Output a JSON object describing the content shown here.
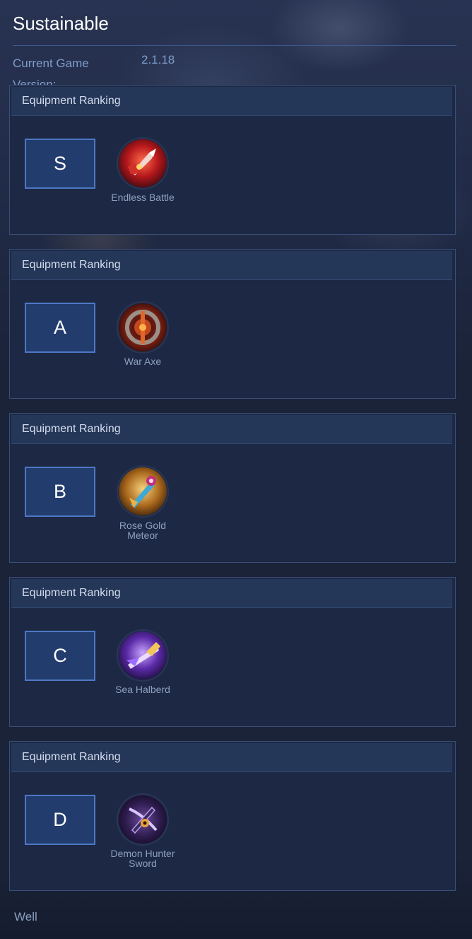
{
  "page": {
    "title": "Sustainable",
    "version_label": "Current Game Version:",
    "version_value": "2.1.18",
    "footer": "Well"
  },
  "cards": [
    {
      "header": "Equipment Ranking",
      "rank": "S",
      "item": {
        "name": "Endless Battle",
        "icon": "endless-battle-icon"
      }
    },
    {
      "header": "Equipment Ranking",
      "rank": "A",
      "item": {
        "name": "War Axe",
        "icon": "war-axe-icon"
      }
    },
    {
      "header": "Equipment Ranking",
      "rank": "B",
      "item": {
        "name": "Rose Gold Meteor",
        "icon": "rose-gold-meteor-icon"
      }
    },
    {
      "header": "Equipment Ranking",
      "rank": "C",
      "item": {
        "name": "Sea Halberd",
        "icon": "sea-halberd-icon"
      }
    },
    {
      "header": "Equipment Ranking",
      "rank": "D",
      "item": {
        "name": "Demon Hunter Sword",
        "icon": "demon-hunter-sword-icon"
      }
    }
  ],
  "colors": {
    "background": "#1b2339",
    "card": "#1d2844",
    "header": "#253759",
    "rank_border": "#4d78c4",
    "rank_fill": "#233c6e",
    "muted_text": "#8da0bf",
    "version_text": "#7f9ccb"
  }
}
